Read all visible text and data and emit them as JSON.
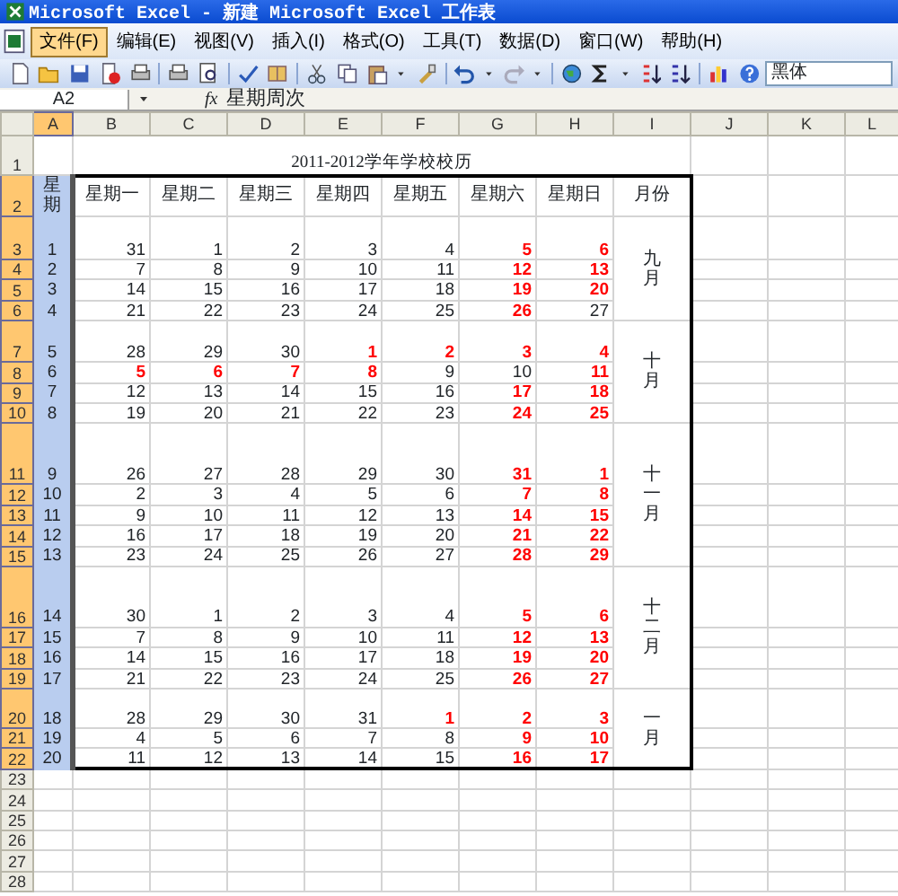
{
  "window": {
    "title": "Microsoft Excel - 新建 Microsoft Excel 工作表"
  },
  "menu": [
    {
      "label": "文件(F)",
      "selected": true
    },
    {
      "label": "编辑(E)",
      "selected": false
    },
    {
      "label": "视图(V)",
      "selected": false
    },
    {
      "label": "插入(I)",
      "selected": false
    },
    {
      "label": "格式(O)",
      "selected": false
    },
    {
      "label": "工具(T)",
      "selected": false
    },
    {
      "label": "数据(D)",
      "selected": false
    },
    {
      "label": "窗口(W)",
      "selected": false
    },
    {
      "label": "帮助(H)",
      "selected": false
    }
  ],
  "toolbar": {
    "font": "黑体"
  },
  "formula_bar": {
    "cell": "A2",
    "function_label": "fx",
    "formula": "星期周次"
  },
  "columns": [
    {
      "label": "A",
      "selected": true
    },
    {
      "label": "B",
      "selected": false
    },
    {
      "label": "C",
      "selected": false
    },
    {
      "label": "D",
      "selected": false
    },
    {
      "label": "E",
      "selected": false
    },
    {
      "label": "F",
      "selected": false
    },
    {
      "label": "G",
      "selected": false
    },
    {
      "label": "H",
      "selected": false
    },
    {
      "label": "I",
      "selected": false
    },
    {
      "label": "J",
      "selected": false
    },
    {
      "label": "K",
      "selected": false
    },
    {
      "label": "L",
      "selected": false
    }
  ],
  "rows": [
    {
      "label": "1",
      "selected": false
    },
    {
      "label": "2",
      "selected": true
    },
    {
      "label": "3",
      "selected": true
    },
    {
      "label": "4",
      "selected": true
    },
    {
      "label": "5",
      "selected": true
    },
    {
      "label": "6",
      "selected": true
    },
    {
      "label": "7",
      "selected": true
    },
    {
      "label": "8",
      "selected": true
    },
    {
      "label": "9",
      "selected": true
    },
    {
      "label": "10",
      "selected": true
    },
    {
      "label": "11",
      "selected": true
    },
    {
      "label": "12",
      "selected": true
    },
    {
      "label": "13",
      "selected": true
    },
    {
      "label": "14",
      "selected": true
    },
    {
      "label": "15",
      "selected": true
    },
    {
      "label": "16",
      "selected": true
    },
    {
      "label": "17",
      "selected": true
    },
    {
      "label": "18",
      "selected": true
    },
    {
      "label": "19",
      "selected": true
    },
    {
      "label": "20",
      "selected": true
    },
    {
      "label": "21",
      "selected": true
    },
    {
      "label": "22",
      "selected": true
    },
    {
      "label": "23",
      "selected": false
    },
    {
      "label": "24",
      "selected": false
    },
    {
      "label": "25",
      "selected": false
    },
    {
      "label": "26",
      "selected": false
    },
    {
      "label": "27",
      "selected": false
    },
    {
      "label": "28",
      "selected": false
    }
  ],
  "sheet": {
    "title": "2011-2012学年学校校历",
    "week_header": "星期",
    "day_headers": [
      "星期一",
      "星期二",
      "星期三",
      "星期四",
      "星期五",
      "星期六",
      "星期日"
    ],
    "month_header": "月份",
    "months": [
      {
        "label": "九月",
        "weeks": [
          {
            "week": "1",
            "days": [
              {
                "text": "31",
                "holiday": false
              },
              {
                "text": "1",
                "holiday": false
              },
              {
                "text": "2",
                "holiday": false
              },
              {
                "text": "3",
                "holiday": false
              },
              {
                "text": "4",
                "holiday": false
              },
              {
                "text": "5",
                "holiday": true
              },
              {
                "text": "6",
                "holiday": true
              }
            ]
          },
          {
            "week": "2",
            "days": [
              {
                "text": "7",
                "holiday": false
              },
              {
                "text": "8",
                "holiday": false
              },
              {
                "text": "9",
                "holiday": false
              },
              {
                "text": "10",
                "holiday": false
              },
              {
                "text": "11",
                "holiday": false
              },
              {
                "text": "12",
                "holiday": true
              },
              {
                "text": "13",
                "holiday": true
              }
            ]
          },
          {
            "week": "3",
            "days": [
              {
                "text": "14",
                "holiday": false
              },
              {
                "text": "15",
                "holiday": false
              },
              {
                "text": "16",
                "holiday": false
              },
              {
                "text": "17",
                "holiday": false
              },
              {
                "text": "18",
                "holiday": false
              },
              {
                "text": "19",
                "holiday": true
              },
              {
                "text": "20",
                "holiday": true
              }
            ]
          },
          {
            "week": "4",
            "days": [
              {
                "text": "21",
                "holiday": false
              },
              {
                "text": "22",
                "holiday": false
              },
              {
                "text": "23",
                "holiday": false
              },
              {
                "text": "24",
                "holiday": false
              },
              {
                "text": "25",
                "holiday": false
              },
              {
                "text": "26",
                "holiday": true
              },
              {
                "text": "27",
                "holiday": false
              }
            ]
          }
        ]
      },
      {
        "label": "十月",
        "weeks": [
          {
            "week": "5",
            "days": [
              {
                "text": "28",
                "holiday": false
              },
              {
                "text": "29",
                "holiday": false
              },
              {
                "text": "30",
                "holiday": false
              },
              {
                "text": "1",
                "holiday": true
              },
              {
                "text": "2",
                "holiday": true
              },
              {
                "text": "3",
                "holiday": true
              },
              {
                "text": "4",
                "holiday": true
              }
            ]
          },
          {
            "week": "6",
            "days": [
              {
                "text": "5",
                "holiday": true
              },
              {
                "text": "6",
                "holiday": true
              },
              {
                "text": "7",
                "holiday": true
              },
              {
                "text": "8",
                "holiday": true
              },
              {
                "text": "9",
                "holiday": false
              },
              {
                "text": "10",
                "holiday": false
              },
              {
                "text": "11",
                "holiday": true
              }
            ]
          },
          {
            "week": "7",
            "days": [
              {
                "text": "12",
                "holiday": false
              },
              {
                "text": "13",
                "holiday": false
              },
              {
                "text": "14",
                "holiday": false
              },
              {
                "text": "15",
                "holiday": false
              },
              {
                "text": "16",
                "holiday": false
              },
              {
                "text": "17",
                "holiday": true
              },
              {
                "text": "18",
                "holiday": true
              }
            ]
          },
          {
            "week": "8",
            "days": [
              {
                "text": "19",
                "holiday": false
              },
              {
                "text": "20",
                "holiday": false
              },
              {
                "text": "21",
                "holiday": false
              },
              {
                "text": "22",
                "holiday": false
              },
              {
                "text": "23",
                "holiday": false
              },
              {
                "text": "24",
                "holiday": true
              },
              {
                "text": "25",
                "holiday": true
              }
            ]
          }
        ]
      },
      {
        "label": "十一月",
        "weeks": [
          {
            "week": "9",
            "days": [
              {
                "text": "26",
                "holiday": false
              },
              {
                "text": "27",
                "holiday": false
              },
              {
                "text": "28",
                "holiday": false
              },
              {
                "text": "29",
                "holiday": false
              },
              {
                "text": "30",
                "holiday": false
              },
              {
                "text": "31",
                "holiday": true
              },
              {
                "text": "1",
                "holiday": true
              }
            ]
          },
          {
            "week": "10",
            "days": [
              {
                "text": "2",
                "holiday": false
              },
              {
                "text": "3",
                "holiday": false
              },
              {
                "text": "4",
                "holiday": false
              },
              {
                "text": "5",
                "holiday": false
              },
              {
                "text": "6",
                "holiday": false
              },
              {
                "text": "7",
                "holiday": true
              },
              {
                "text": "8",
                "holiday": true
              }
            ]
          },
          {
            "week": "11",
            "days": [
              {
                "text": "9",
                "holiday": false
              },
              {
                "text": "10",
                "holiday": false
              },
              {
                "text": "11",
                "holiday": false
              },
              {
                "text": "12",
                "holiday": false
              },
              {
                "text": "13",
                "holiday": false
              },
              {
                "text": "14",
                "holiday": true
              },
              {
                "text": "15",
                "holiday": true
              }
            ]
          },
          {
            "week": "12",
            "days": [
              {
                "text": "16",
                "holiday": false
              },
              {
                "text": "17",
                "holiday": false
              },
              {
                "text": "18",
                "holiday": false
              },
              {
                "text": "19",
                "holiday": false
              },
              {
                "text": "20",
                "holiday": false
              },
              {
                "text": "21",
                "holiday": true
              },
              {
                "text": "22",
                "holiday": true
              }
            ]
          },
          {
            "week": "13",
            "days": [
              {
                "text": "23",
                "holiday": false
              },
              {
                "text": "24",
                "holiday": false
              },
              {
                "text": "25",
                "holiday": false
              },
              {
                "text": "26",
                "holiday": false
              },
              {
                "text": "27",
                "holiday": false
              },
              {
                "text": "28",
                "holiday": true
              },
              {
                "text": "29",
                "holiday": true
              }
            ]
          }
        ]
      },
      {
        "label": "十二月",
        "weeks": [
          {
            "week": "14",
            "days": [
              {
                "text": "30",
                "holiday": false
              },
              {
                "text": "1",
                "holiday": false
              },
              {
                "text": "2",
                "holiday": false
              },
              {
                "text": "3",
                "holiday": false
              },
              {
                "text": "4",
                "holiday": false
              },
              {
                "text": "5",
                "holiday": true
              },
              {
                "text": "6",
                "holiday": true
              }
            ]
          },
          {
            "week": "15",
            "days": [
              {
                "text": "7",
                "holiday": false
              },
              {
                "text": "8",
                "holiday": false
              },
              {
                "text": "9",
                "holiday": false
              },
              {
                "text": "10",
                "holiday": false
              },
              {
                "text": "11",
                "holiday": false
              },
              {
                "text": "12",
                "holiday": true
              },
              {
                "text": "13",
                "holiday": true
              }
            ]
          },
          {
            "week": "16",
            "days": [
              {
                "text": "14",
                "holiday": false
              },
              {
                "text": "15",
                "holiday": false
              },
              {
                "text": "16",
                "holiday": false
              },
              {
                "text": "17",
                "holiday": false
              },
              {
                "text": "18",
                "holiday": false
              },
              {
                "text": "19",
                "holiday": true
              },
              {
                "text": "20",
                "holiday": true
              }
            ]
          },
          {
            "week": "17",
            "days": [
              {
                "text": "21",
                "holiday": false
              },
              {
                "text": "22",
                "holiday": false
              },
              {
                "text": "23",
                "holiday": false
              },
              {
                "text": "24",
                "holiday": false
              },
              {
                "text": "25",
                "holiday": false
              },
              {
                "text": "26",
                "holiday": true
              },
              {
                "text": "27",
                "holiday": true
              }
            ]
          }
        ]
      },
      {
        "label": "一月",
        "weeks": [
          {
            "week": "18",
            "days": [
              {
                "text": "28",
                "holiday": false
              },
              {
                "text": "29",
                "holiday": false
              },
              {
                "text": "30",
                "holiday": false
              },
              {
                "text": "31",
                "holiday": false
              },
              {
                "text": "1",
                "holiday": true
              },
              {
                "text": "2",
                "holiday": true
              },
              {
                "text": "3",
                "holiday": true
              }
            ]
          },
          {
            "week": "19",
            "days": [
              {
                "text": "4",
                "holiday": false
              },
              {
                "text": "5",
                "holiday": false
              },
              {
                "text": "6",
                "holiday": false
              },
              {
                "text": "7",
                "holiday": false
              },
              {
                "text": "8",
                "holiday": false
              },
              {
                "text": "9",
                "holiday": true
              },
              {
                "text": "10",
                "holiday": true
              }
            ]
          },
          {
            "week": "20",
            "days": [
              {
                "text": "11",
                "holiday": false
              },
              {
                "text": "12",
                "holiday": false
              },
              {
                "text": "13",
                "holiday": false
              },
              {
                "text": "14",
                "holiday": false
              },
              {
                "text": "15",
                "holiday": false
              },
              {
                "text": "16",
                "holiday": true
              },
              {
                "text": "17",
                "holiday": true
              }
            ]
          }
        ]
      }
    ]
  }
}
